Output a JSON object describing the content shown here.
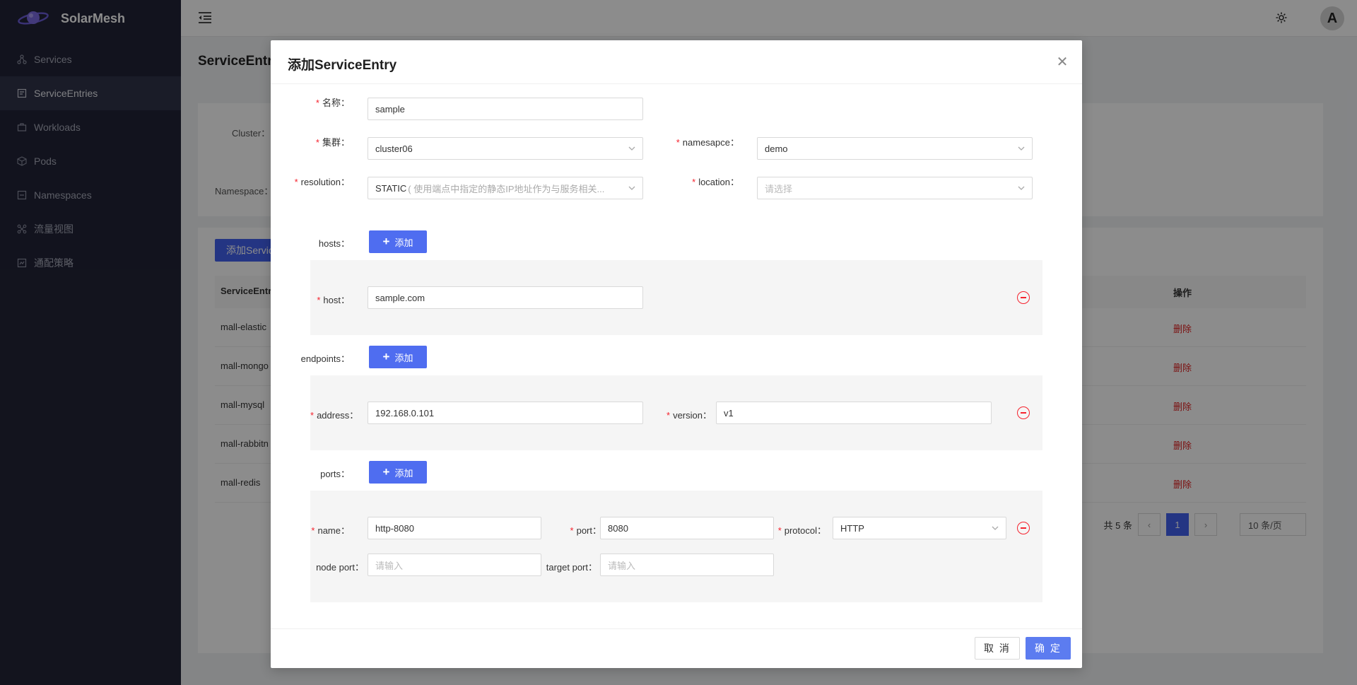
{
  "app": {
    "name": "SolarMesh"
  },
  "sidebar": {
    "items": [
      {
        "label": "Services",
        "icon": "network-icon",
        "active": false
      },
      {
        "label": "ServiceEntries",
        "icon": "entry-icon",
        "active": true
      },
      {
        "label": "Workloads",
        "icon": "briefcase-icon",
        "active": false
      },
      {
        "label": "Pods",
        "icon": "cube-icon",
        "active": false
      },
      {
        "label": "Namespaces",
        "icon": "folder-icon",
        "active": false
      },
      {
        "label": "流量视图",
        "icon": "graph-icon",
        "active": false
      },
      {
        "label": "通配策略",
        "icon": "policy-icon",
        "active": false
      }
    ]
  },
  "header": {
    "avatar_letter": "A"
  },
  "page": {
    "title": "ServiceEntr",
    "filter": {
      "cluster_label": "Cluster：",
      "namespace_label": "Namespace："
    },
    "add_button": "添加Servic",
    "table": {
      "header_name": "ServiceEntr",
      "header_action": "操作",
      "rows": [
        {
          "name": "mall-elastic",
          "action": "删除"
        },
        {
          "name": "mall-mongo",
          "action": "删除"
        },
        {
          "name": "mall-mysql",
          "action": "删除"
        },
        {
          "name": "mall-rabbitn",
          "action": "删除"
        },
        {
          "name": "mall-redis",
          "action": "删除"
        }
      ]
    },
    "pagination": {
      "total": "共 5 条",
      "current": "1",
      "page_size": "10 条/页"
    }
  },
  "modal": {
    "title": "添加ServiceEntry",
    "fields": {
      "name": {
        "label": "名称：",
        "value": "sample"
      },
      "cluster": {
        "label": "集群：",
        "value": "cluster06"
      },
      "namespace": {
        "label": "namesapce：",
        "value": "demo"
      },
      "resolution": {
        "label": "resolution：",
        "value": "STATIC",
        "hint": "( 使用端点中指定的静态IP地址作为与服务相关..."
      },
      "location": {
        "label": "location：",
        "placeholder": "请选择"
      }
    },
    "hosts": {
      "label": "hosts：",
      "add": "添加",
      "items": [
        {
          "label": "host：",
          "value": "sample.com"
        }
      ]
    },
    "endpoints": {
      "label": "endpoints：",
      "add": "添加",
      "items": [
        {
          "address_label": "address：",
          "address": "192.168.0.101",
          "version_label": "version：",
          "version": "v1"
        }
      ]
    },
    "ports": {
      "label": "ports：",
      "add": "添加",
      "items": [
        {
          "name_label": "name：",
          "name": "http-8080",
          "port_label": "port：",
          "port": "8080",
          "protocol_label": "protocol：",
          "protocol": "HTTP",
          "node_port_label": "node port：",
          "node_port_placeholder": "请输入",
          "target_port_label": "target port：",
          "target_port_placeholder": "请输入"
        }
      ]
    },
    "footer": {
      "cancel": "取 消",
      "ok": "确 定"
    }
  },
  "colors": {
    "primary": "#4f6df0",
    "danger": "#f5222d",
    "sidebar_bg": "#222437"
  }
}
